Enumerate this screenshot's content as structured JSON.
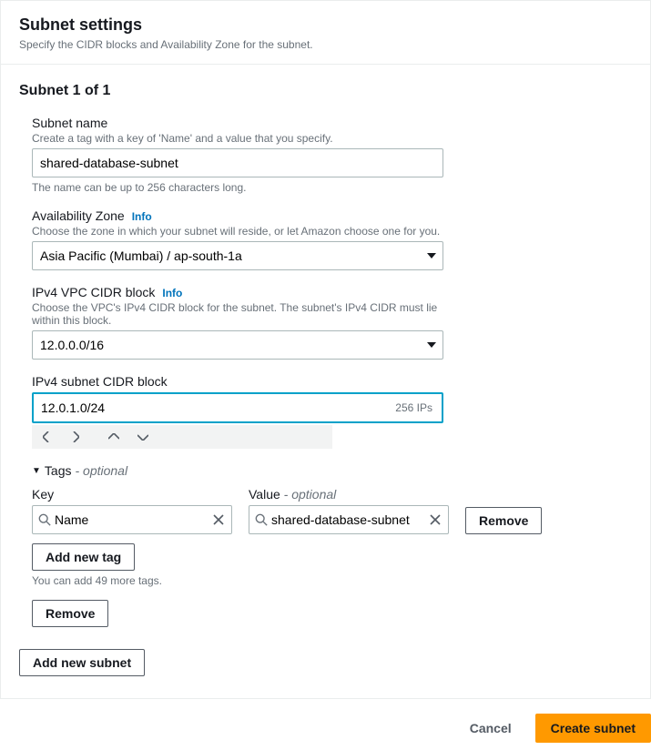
{
  "header": {
    "title": "Subnet settings",
    "subtitle": "Specify the CIDR blocks and Availability Zone for the subnet."
  },
  "section_title": "Subnet 1 of 1",
  "fields": {
    "subnet_name": {
      "label": "Subnet name",
      "desc": "Create a tag with a key of 'Name' and a value that you specify.",
      "value": "shared-database-subnet",
      "hint": "The name can be up to 256 characters long."
    },
    "az": {
      "label": "Availability Zone",
      "info": "Info",
      "desc": "Choose the zone in which your subnet will reside, or let Amazon choose one for you.",
      "value": "Asia Pacific (Mumbai) / ap-south-1a"
    },
    "vpc_cidr": {
      "label": "IPv4 VPC CIDR block",
      "info": "Info",
      "desc": "Choose the VPC's IPv4 CIDR block for the subnet. The subnet's IPv4 CIDR must lie within this block.",
      "value": "12.0.0.0/16"
    },
    "subnet_cidr": {
      "label": "IPv4 subnet CIDR block",
      "value": "12.0.1.0/24",
      "ip_count": "256 IPs"
    }
  },
  "tags": {
    "header_label": "Tags",
    "header_suffix": " - optional",
    "key_label": "Key",
    "value_label": "Value",
    "value_suffix": " - optional",
    "row": {
      "key": "Name",
      "value": "shared-database-subnet"
    },
    "remove_label": "Remove",
    "add_new_tag": "Add new tag",
    "more_tags_hint": "You can add 49 more tags."
  },
  "subnet_remove_label": "Remove",
  "add_new_subnet": "Add new subnet",
  "footer": {
    "cancel": "Cancel",
    "create": "Create subnet"
  }
}
